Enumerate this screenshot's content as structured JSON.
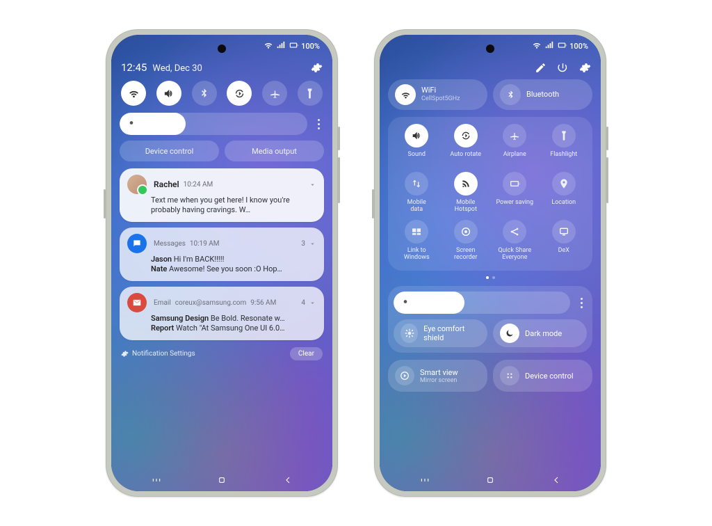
{
  "status": {
    "battery": "100%"
  },
  "left": {
    "time": "12:45",
    "date": "Wed, Dec 30",
    "brightness_fill": "35%",
    "quick_toggles": [
      {
        "name": "wifi",
        "on": true
      },
      {
        "name": "sound",
        "on": true
      },
      {
        "name": "bluetooth",
        "on": false
      },
      {
        "name": "auto-rotate",
        "on": true
      },
      {
        "name": "airplane",
        "on": false
      },
      {
        "name": "flashlight",
        "on": false
      }
    ],
    "pills": {
      "device_control": "Device control",
      "media_output": "Media output"
    },
    "notification_settings": "Notification Settings",
    "clear": "Clear",
    "notifications": [
      {
        "kind": "conversation",
        "sender": "Rachel",
        "time": "10:24 AM",
        "body": "Text me when you get here! I know you're probably having cravings. W…"
      },
      {
        "kind": "group",
        "app": "Messages",
        "time": "10:19 AM",
        "count": "3",
        "lines": [
          {
            "from": "Jason",
            "text": "Hi I'm BACK!!!!!"
          },
          {
            "from": "Nate",
            "text": "Awesome! See you soon :O Hop…"
          }
        ]
      },
      {
        "kind": "group",
        "app": "Email",
        "sub": "coreux@samsung.com",
        "time": "9:56 AM",
        "count": "4",
        "lines": [
          {
            "from": "Samsung Design",
            "text": "Be Bold. Resonate w…"
          },
          {
            "from": "Report",
            "text": "Watch \"At Samsung One UI 6.0…"
          }
        ]
      }
    ]
  },
  "right": {
    "wifi": {
      "label": "WiFi",
      "sub": "CellSpot5GHz",
      "on": true
    },
    "bt": {
      "label": "Bluetooth",
      "on": false
    },
    "grid": [
      [
        {
          "name": "sound",
          "label": "Sound",
          "on": true
        },
        {
          "name": "auto-rotate",
          "label": "Auto rotate",
          "on": true
        },
        {
          "name": "airplane",
          "label": "Airplane",
          "on": false
        },
        {
          "name": "flashlight",
          "label": "Flashlight",
          "on": false
        }
      ],
      [
        {
          "name": "mobile-data",
          "label": "Mobile\ndata",
          "on": false
        },
        {
          "name": "mobile-hotspot",
          "label": "Mobile\nHotspot",
          "on": true
        },
        {
          "name": "power-saving",
          "label": "Power saving",
          "on": false
        },
        {
          "name": "location",
          "label": "Location",
          "on": false
        }
      ],
      [
        {
          "name": "link-windows",
          "label": "Link to\nWindows",
          "on": false
        },
        {
          "name": "screen-recorder",
          "label": "Screen\nrecorder",
          "on": false
        },
        {
          "name": "quick-share",
          "label": "Quick Share\nEveryone",
          "on": false
        },
        {
          "name": "dex",
          "label": "DeX",
          "on": false
        }
      ]
    ],
    "brightness_fill": "40%",
    "eye": "Eye comfort shield",
    "dark": "Dark mode",
    "smart": {
      "label": "Smart view",
      "sub": "Mirror screen"
    },
    "device_control": "Device control"
  }
}
